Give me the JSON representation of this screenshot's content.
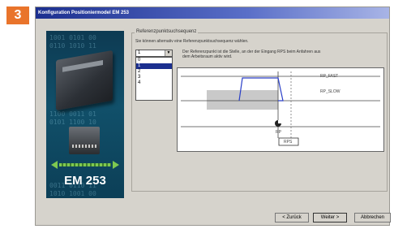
{
  "step_number": "3",
  "window": {
    "title": "Konfiguration Positioniermodel EM 253"
  },
  "side_panel": {
    "binary_rows": [
      "1001 0101 00",
      "0110 1010 11",
      "1100 0011 01",
      "0101 1100 10",
      "0011 0110 11",
      "1010 1001 00"
    ],
    "model_label": "EM 253"
  },
  "group": {
    "title": "Referenzpunktsuchsequenz",
    "instruction": "Sie können alternativ eine Referenzpunktsuchsequenz wählen.",
    "description_line1": "Der Referenzpunkt ist die Stelle, an der der Eingang RPS beim Anfahren aus",
    "description_line2": "dem Arbeitsraum aktiv wird."
  },
  "sequence_select": {
    "value": "1",
    "options": [
      "0",
      "1",
      "2",
      "3",
      "4"
    ],
    "highlighted_index": 1
  },
  "diagram": {
    "labels": {
      "fast": "RP_FAST",
      "slow": "RP_SLOW",
      "rp": "RP",
      "rps": "RPS"
    },
    "colors": {
      "path": "#2a3fc8",
      "slow_band": "#c9c9c9",
      "axis": "#444444"
    }
  },
  "buttons": {
    "back": "< Zurück",
    "next": "Weiter >",
    "cancel": "Abbrechen"
  },
  "colors": {
    "accent": "#e9742b",
    "titlebar": "#1b2f8f",
    "dialog_bg": "#d6d3cc"
  }
}
